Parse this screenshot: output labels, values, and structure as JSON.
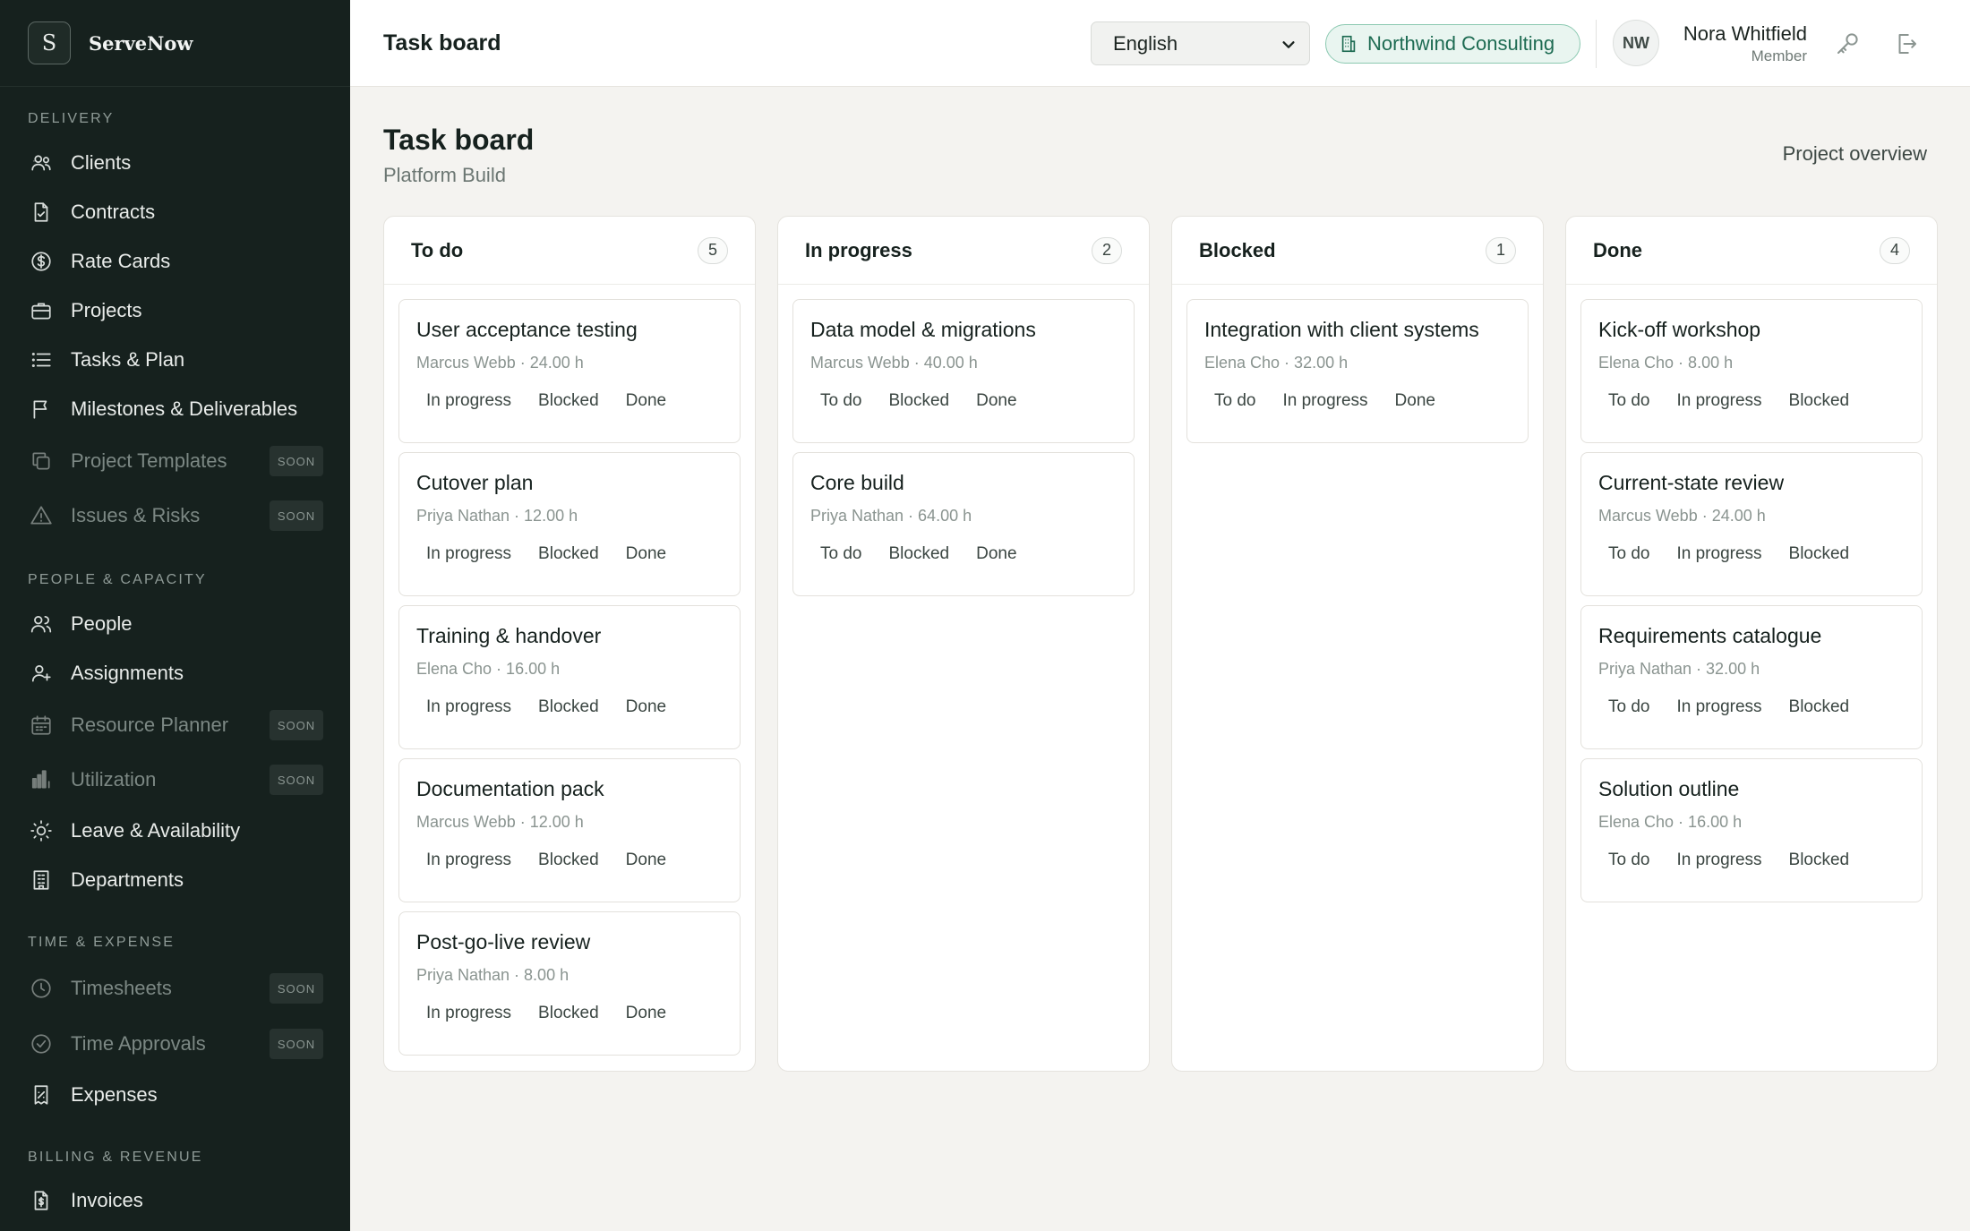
{
  "brand": {
    "logo_letter": "S",
    "name": "ServeNow"
  },
  "sidebar": {
    "sections": [
      {
        "label": "DELIVERY",
        "items": [
          {
            "label": "Clients",
            "icon": "users-icon",
            "soon": false
          },
          {
            "label": "Contracts",
            "icon": "file-check-icon",
            "soon": false
          },
          {
            "label": "Rate Cards",
            "icon": "dollar-circle-icon",
            "soon": false
          },
          {
            "label": "Projects",
            "icon": "briefcase-icon",
            "soon": false
          },
          {
            "label": "Tasks & Plan",
            "icon": "list-icon",
            "soon": false
          },
          {
            "label": "Milestones & Deliverables",
            "icon": "flag-icon",
            "soon": false
          },
          {
            "label": "Project Templates",
            "icon": "copy-icon",
            "soon": true
          },
          {
            "label": "Issues & Risks",
            "icon": "warning-icon",
            "soon": true
          }
        ]
      },
      {
        "label": "PEOPLE & CAPACITY",
        "items": [
          {
            "label": "People",
            "icon": "people-icon",
            "soon": false
          },
          {
            "label": "Assignments",
            "icon": "user-plus-icon",
            "soon": false
          },
          {
            "label": "Resource Planner",
            "icon": "calendar-icon",
            "soon": true
          },
          {
            "label": "Utilization",
            "icon": "bar-chart-icon",
            "soon": true
          },
          {
            "label": "Leave & Availability",
            "icon": "sun-icon",
            "soon": false
          },
          {
            "label": "Departments",
            "icon": "building-icon",
            "soon": false
          }
        ]
      },
      {
        "label": "TIME & EXPENSE",
        "items": [
          {
            "label": "Timesheets",
            "icon": "clock-icon",
            "soon": true
          },
          {
            "label": "Time Approvals",
            "icon": "check-circle-icon",
            "soon": true
          },
          {
            "label": "Expenses",
            "icon": "receipt-icon",
            "soon": false
          }
        ]
      },
      {
        "label": "BILLING & REVENUE",
        "items": [
          {
            "label": "Invoices",
            "icon": "invoice-icon",
            "soon": false
          }
        ]
      }
    ],
    "soon_label": "SOON"
  },
  "topbar": {
    "title": "Task board",
    "language": "English",
    "organization": "Northwind Consulting",
    "user": {
      "initials": "NW",
      "name": "Nora Whitfield",
      "role": "Member"
    }
  },
  "page": {
    "title": "Task board",
    "subtitle": "Platform Build",
    "overview_label": "Project overview"
  },
  "columns": [
    {
      "title": "To do",
      "count": "5",
      "cards": [
        {
          "title": "User acceptance testing",
          "meta": "Marcus Webb · 24.00 h",
          "actions": [
            "In progress",
            "Blocked",
            "Done"
          ]
        },
        {
          "title": "Cutover plan",
          "meta": "Priya Nathan · 12.00 h",
          "actions": [
            "In progress",
            "Blocked",
            "Done"
          ]
        },
        {
          "title": "Training & handover",
          "meta": "Elena Cho · 16.00 h",
          "actions": [
            "In progress",
            "Blocked",
            "Done"
          ]
        },
        {
          "title": "Documentation pack",
          "meta": "Marcus Webb · 12.00 h",
          "actions": [
            "In progress",
            "Blocked",
            "Done"
          ]
        },
        {
          "title": "Post-go-live review",
          "meta": "Priya Nathan · 8.00 h",
          "actions": [
            "In progress",
            "Blocked",
            "Done"
          ]
        }
      ]
    },
    {
      "title": "In progress",
      "count": "2",
      "cards": [
        {
          "title": "Data model & migrations",
          "meta": "Marcus Webb · 40.00 h",
          "actions": [
            "To do",
            "Blocked",
            "Done"
          ]
        },
        {
          "title": "Core build",
          "meta": "Priya Nathan · 64.00 h",
          "actions": [
            "To do",
            "Blocked",
            "Done"
          ]
        }
      ]
    },
    {
      "title": "Blocked",
      "count": "1",
      "cards": [
        {
          "title": "Integration with client systems",
          "meta": "Elena Cho · 32.00 h",
          "actions": [
            "To do",
            "In progress",
            "Done"
          ]
        }
      ]
    },
    {
      "title": "Done",
      "count": "4",
      "cards": [
        {
          "title": "Kick-off workshop",
          "meta": "Elena Cho · 8.00 h",
          "actions": [
            "To do",
            "In progress",
            "Blocked"
          ]
        },
        {
          "title": "Current-state review",
          "meta": "Marcus Webb · 24.00 h",
          "actions": [
            "To do",
            "In progress",
            "Blocked"
          ]
        },
        {
          "title": "Requirements catalogue",
          "meta": "Priya Nathan · 32.00 h",
          "actions": [
            "To do",
            "In progress",
            "Blocked"
          ]
        },
        {
          "title": "Solution outline",
          "meta": "Elena Cho · 16.00 h",
          "actions": [
            "To do",
            "In progress",
            "Blocked"
          ]
        }
      ]
    }
  ]
}
